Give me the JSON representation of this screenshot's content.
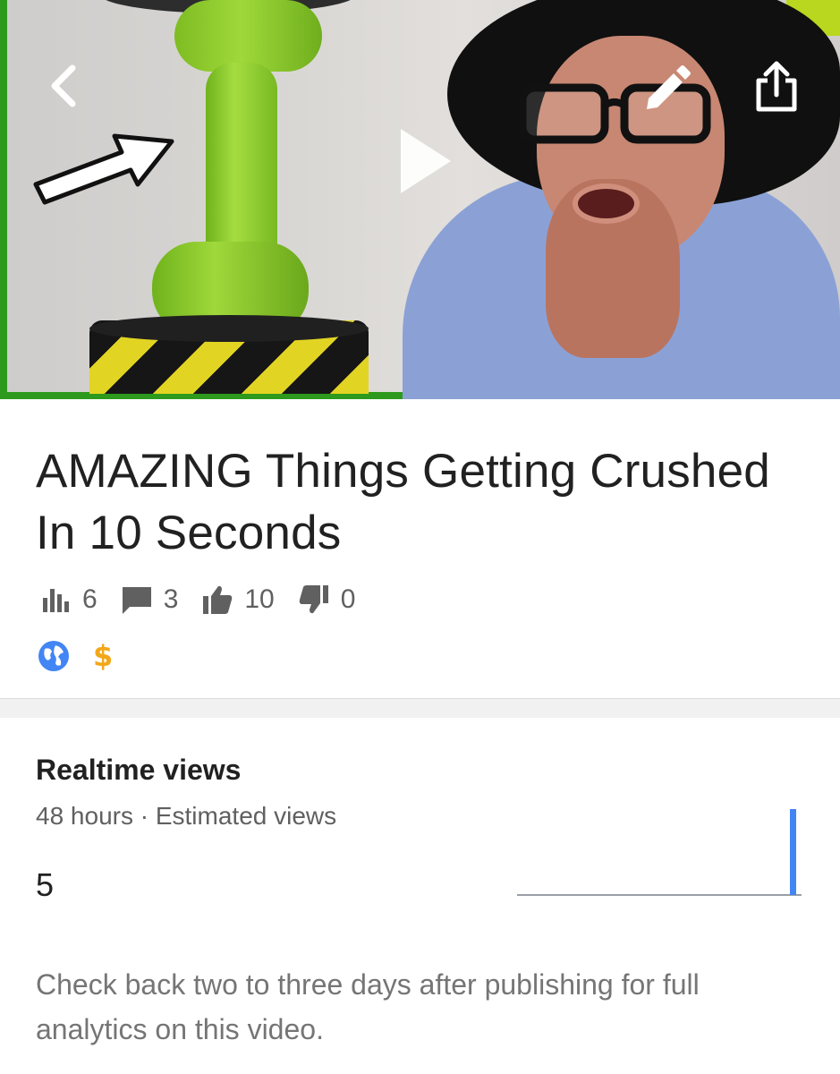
{
  "video": {
    "title": "AMAZING Things Getting Crushed In 10 Seconds",
    "stats": {
      "views": "6",
      "comments": "3",
      "likes": "10",
      "dislikes": "0"
    },
    "badges": {
      "visibility_icon": "globe-icon",
      "monetization_symbol": "$"
    }
  },
  "header": {
    "back_icon": "chevron-left-icon",
    "play_icon": "play-icon",
    "edit_icon": "pencil-icon",
    "share_icon": "share-icon"
  },
  "realtime": {
    "title": "Realtime views",
    "subtitle": "48 hours · Estimated views",
    "value": "5",
    "note": "Check back two to three days after publishing for full analytics on this video."
  },
  "colors": {
    "accent_blue": "#4285f4",
    "monetization_gold": "#f2a71b",
    "thumbnail_border_green": "#2e9a1d"
  }
}
